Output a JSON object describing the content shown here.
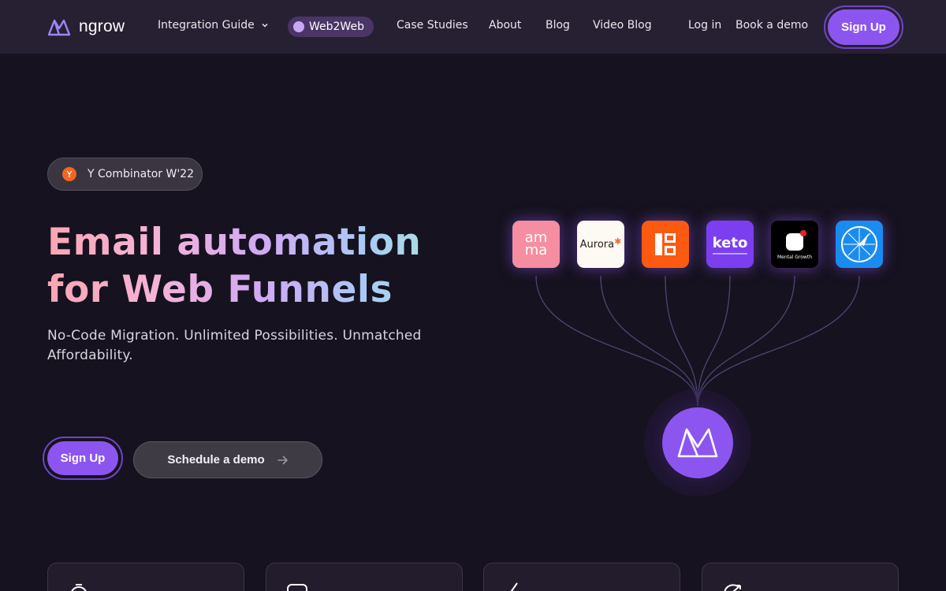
{
  "brand": {
    "name": "ngrow"
  },
  "nav": {
    "items": [
      {
        "label": "Integration Guide"
      },
      {
        "label": "Web2Web"
      },
      {
        "label": "Case Studies"
      },
      {
        "label": "About"
      },
      {
        "label": "Blog"
      },
      {
        "label": "Video Blog"
      }
    ],
    "login": "Log in",
    "book_demo": "Book a demo",
    "signup": "Sign Up"
  },
  "hero": {
    "badge": "Y Combinator W'22",
    "badge_icon_text": "Y",
    "headline_line1": "Email automation",
    "headline_line2": "for Web Funnels",
    "subtitle": "No-Code Migration. Unlimited Possibilities. Unmatched Affordability.",
    "signup": "Sign Up",
    "schedule_demo": "Schedule a demo"
  },
  "integrations": {
    "apps": [
      {
        "name": "amma",
        "text_top": "am",
        "text_bottom": "ma"
      },
      {
        "name": "aurora",
        "text": "Aurora"
      },
      {
        "name": "app-3"
      },
      {
        "name": "keto",
        "text": "keto"
      },
      {
        "name": "mental-growth",
        "text": "Mental Growth"
      },
      {
        "name": "compass-app"
      }
    ]
  },
  "colors": {
    "background": "#16121f",
    "nav_bg": "#272033",
    "accent": "#8d55f0"
  }
}
